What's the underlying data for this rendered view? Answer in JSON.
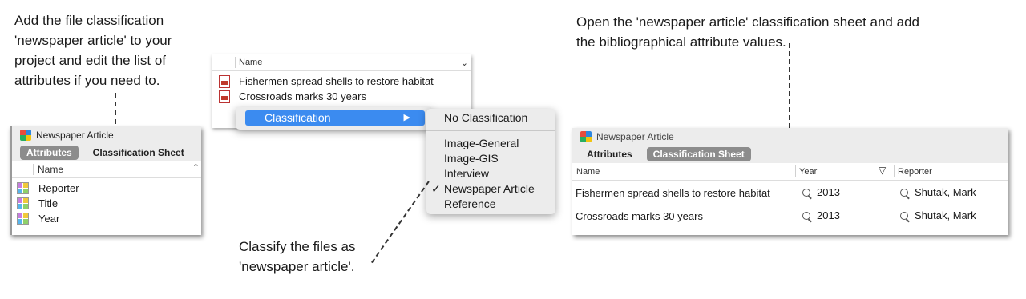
{
  "captions": {
    "left": [
      "Add the file classification",
      "'newspaper article' to your",
      "project and edit the list of",
      "attributes if you need to."
    ],
    "middle": [
      "Classify the files as",
      "'newspaper article'."
    ],
    "right": [
      "Open the 'newspaper article' classification sheet and add",
      "the bibliographical attribute values."
    ]
  },
  "left_panel": {
    "title": "Newspaper Article",
    "tabs": [
      "Attributes",
      "Classification Sheet"
    ],
    "active_tab": "Attributes",
    "column_header": "Name",
    "attributes": [
      "Reporter",
      "Title",
      "Year"
    ]
  },
  "middle_panel": {
    "column_header": "Name",
    "files": [
      "Fishermen spread shells to restore habitat",
      "Crossroads marks 30 years"
    ],
    "context_menu_item": "Classification",
    "submenu": {
      "top": "No Classification",
      "items": [
        "Image-General",
        "Image-GIS",
        "Interview",
        "Newspaper Article",
        "Reference"
      ],
      "checked": "Newspaper Article"
    }
  },
  "right_panel": {
    "title": "Newspaper Article",
    "tabs": [
      "Attributes",
      "Classification Sheet"
    ],
    "active_tab": "Classification Sheet",
    "columns": [
      "Name",
      "Year",
      "Reporter"
    ],
    "rows": [
      {
        "name": "Fishermen spread shells to restore habitat",
        "year": "2013",
        "reporter": "Shutak, Mark"
      },
      {
        "name": "Crossroads marks 30 years",
        "year": "2013",
        "reporter": "Shutak, Mark"
      }
    ]
  },
  "icons": {
    "classification": "classification-icon",
    "attribute": "attribute-icon",
    "document": "pdf-document-icon",
    "search": "magnifier-icon",
    "filter": "filter-icon",
    "checkmark": "checkmark-icon"
  }
}
